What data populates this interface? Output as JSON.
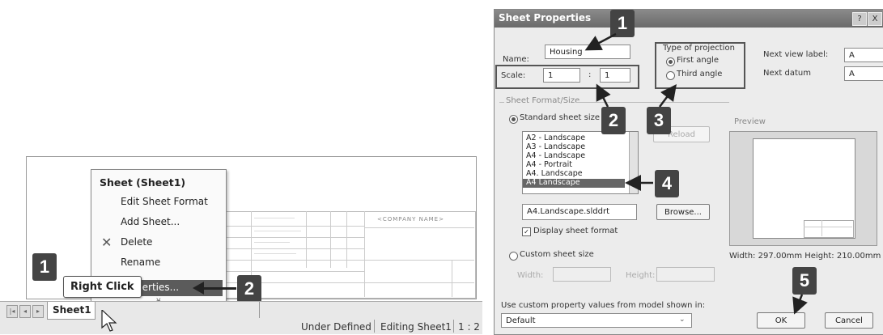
{
  "left": {
    "context_menu": {
      "title": "Sheet (Sheet1)",
      "items": [
        "Edit Sheet Format",
        "Add Sheet...",
        "Delete",
        "Rename",
        "Properties..."
      ],
      "more_glyph": "¥"
    },
    "sheet_tab": "Sheet1",
    "company_name": "<COMPANY NAME>",
    "status": {
      "state": "Under Defined",
      "editing": "Editing Sheet1",
      "scale": "1 : 2"
    },
    "right_click_label": "Right Click",
    "callouts": [
      "1",
      "2"
    ]
  },
  "dialog": {
    "title": "Sheet Properties",
    "title_buttons": [
      "?",
      "X"
    ],
    "name_label": "Name:",
    "name_value": "Housing",
    "scale_label": "Scale:",
    "scale_a": "1",
    "scale_colon": ":",
    "scale_b": "1",
    "projection_title": "Type of projection",
    "first_angle": "First angle",
    "third_angle": "Third angle",
    "next_view_label": "Next view label:",
    "next_view_value": "A",
    "next_datum_label": "Next datum",
    "next_datum_value": "A",
    "format_group": "Sheet Format/Size",
    "standard_size": "Standard sheet size",
    "reload": "Reload",
    "list_items": [
      "A2 - Landscape",
      "A3 - Landscape",
      "A4 - Landscape",
      "A4 - Portrait",
      "A4. Landscape",
      "A4 Landscape"
    ],
    "format_file": "A4.Landscape.slddrt",
    "browse": "Browse...",
    "display_format": "Display sheet format",
    "custom_size": "Custom sheet size",
    "width_label": "Width:",
    "height_label": "Height:",
    "preview_label": "Preview",
    "dims": "Width: 297.00mm  Height: 210.00mm",
    "custom_prop_label": "Use custom property values from model shown in:",
    "custom_prop_value": "Default",
    "ok": "OK",
    "cancel": "Cancel",
    "callouts": [
      "1",
      "2",
      "3",
      "4",
      "5"
    ]
  }
}
